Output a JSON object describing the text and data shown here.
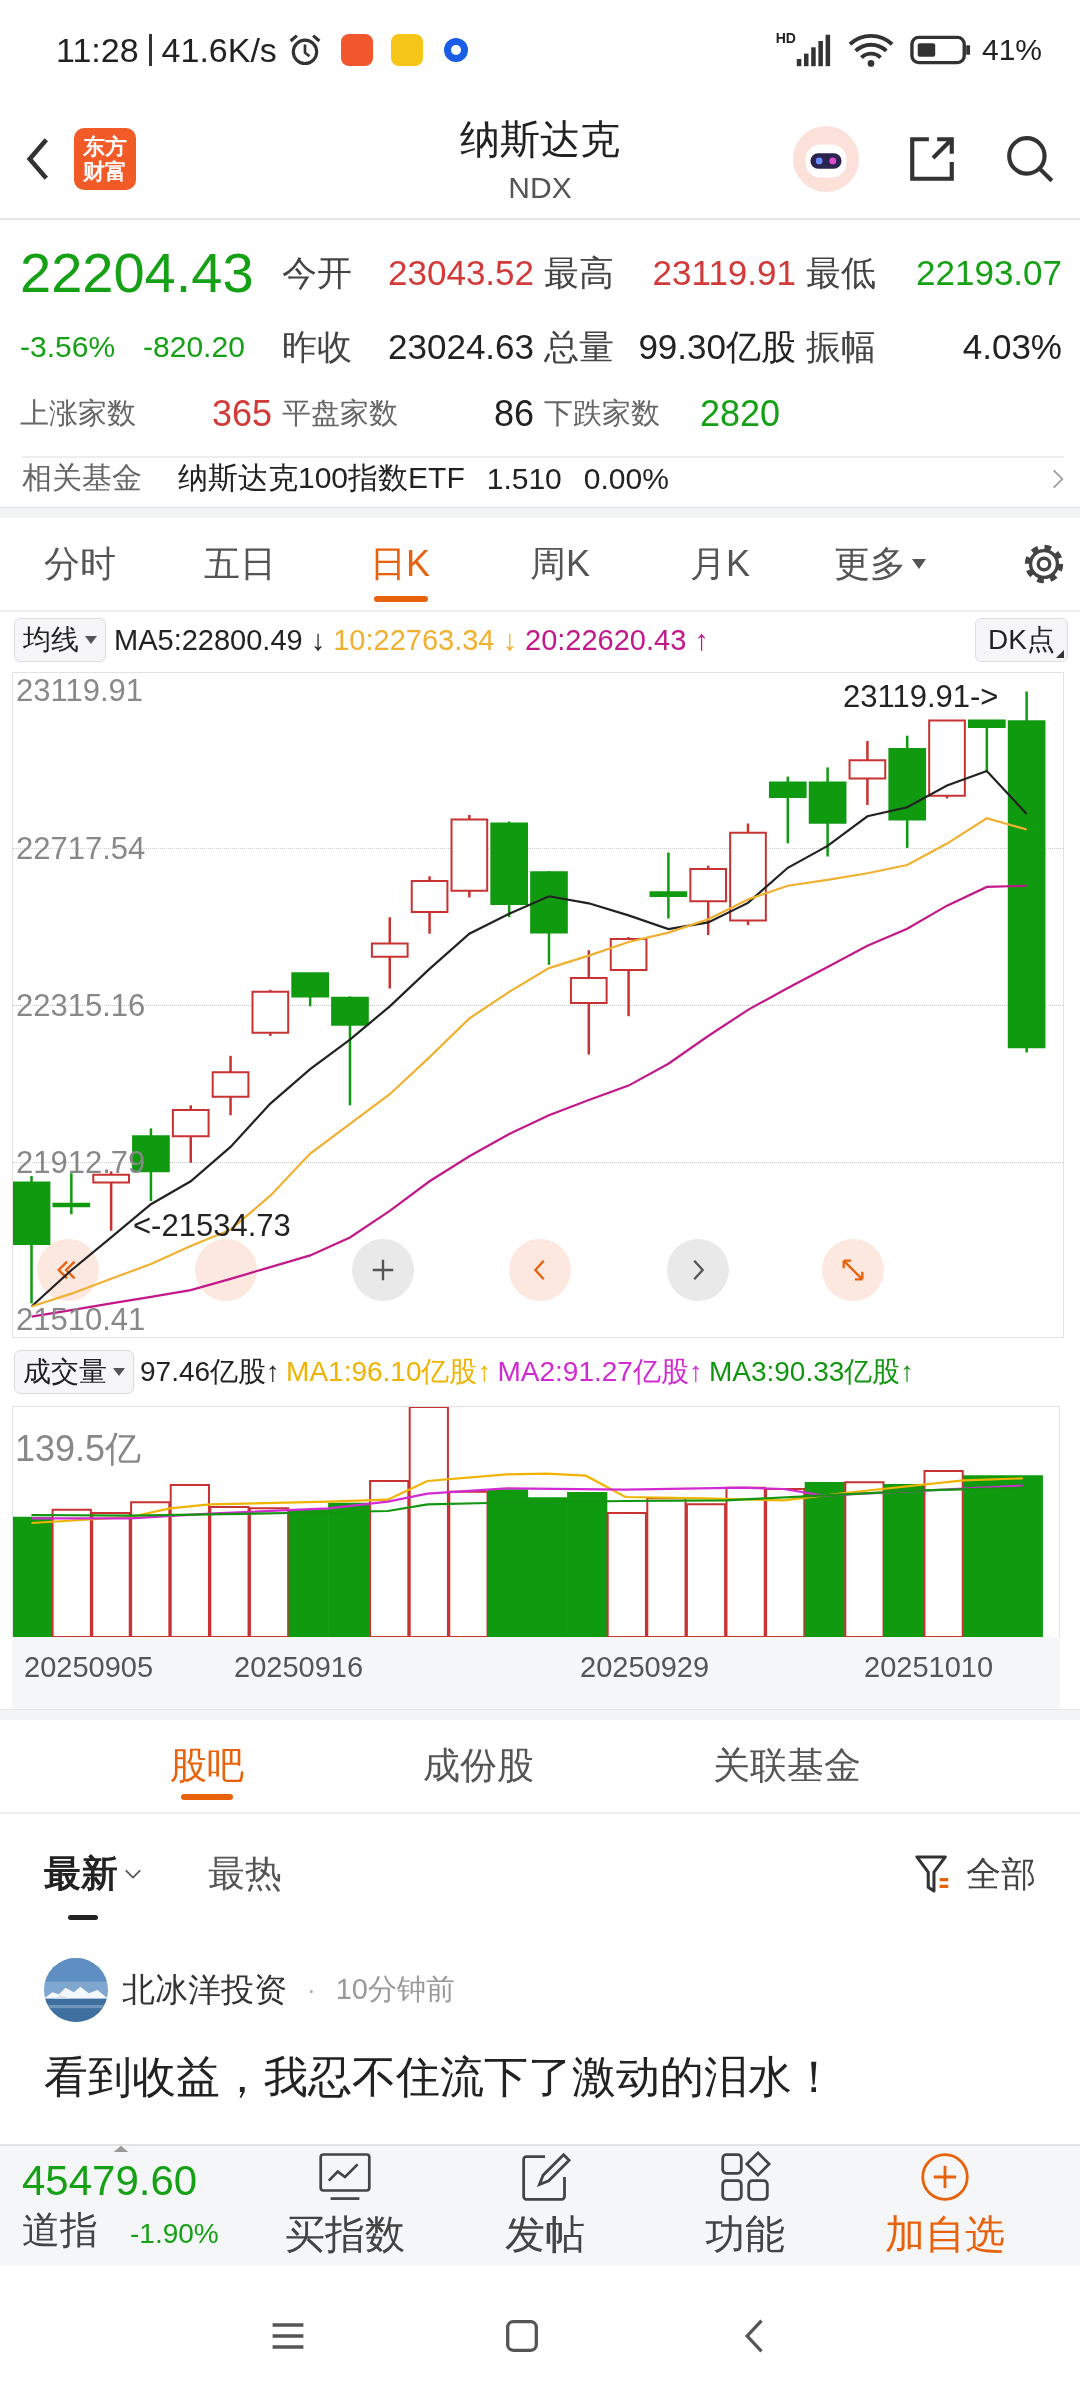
{
  "status_bar": {
    "time": "11:28",
    "speed": "41.6K/s",
    "network": "HD",
    "battery": "41%"
  },
  "header": {
    "logo_lines": [
      "东方",
      "财富"
    ],
    "title": "纳斯达克",
    "subtitle": "NDX"
  },
  "quote": {
    "price": "22204.43",
    "color": "#16a016",
    "change_pct": "-3.56%",
    "change": "-820.20",
    "stats": [
      {
        "label": "今开",
        "value": "23043.52",
        "color": "#d23a3a"
      },
      {
        "label": "最高",
        "value": "23119.91",
        "color": "#d23a3a"
      },
      {
        "label": "最低",
        "value": "22193.07",
        "color": "#16a016"
      },
      {
        "label": "昨收",
        "value": "23024.63",
        "color": "#222222"
      },
      {
        "label": "总量",
        "value": "99.30亿股",
        "color": "#222222"
      },
      {
        "label": "振幅",
        "value": "4.03%",
        "color": "#222222"
      }
    ],
    "breadth": [
      {
        "label": "上涨家数",
        "value": "365",
        "color": "#d23a3a"
      },
      {
        "label": "平盘家数",
        "value": "86",
        "color": "#222222"
      },
      {
        "label": "下跌家数",
        "value": "2820",
        "color": "#16a016"
      }
    ]
  },
  "fund": {
    "label": "相关基金",
    "name": "纳斯达克100指数ETF",
    "price": "1.510",
    "change": "0.00%"
  },
  "chart_tabs": [
    {
      "label": "分时",
      "selected": false,
      "kind": "tab"
    },
    {
      "label": "五日",
      "selected": false,
      "kind": "tab"
    },
    {
      "label": "日K",
      "selected": true,
      "kind": "tab"
    },
    {
      "label": "周K",
      "selected": false,
      "kind": "tab"
    },
    {
      "label": "月K",
      "selected": false,
      "kind": "tab"
    },
    {
      "label": "更多",
      "selected": false,
      "kind": "menu"
    }
  ],
  "ma_legend": {
    "selector": "均线",
    "dk": "DK点",
    "items": [
      {
        "text": "MA5:22800.49",
        "arrow": "↓",
        "color": "#222222"
      },
      {
        "text": "10:22763.34",
        "arrow": "↓",
        "color": "#f0b030"
      },
      {
        "text": "20:22620.43",
        "arrow": "↑",
        "color": "#c2188a"
      }
    ]
  },
  "kline": {
    "high_marker": "23119.91->",
    "low_marker": "<-21534.73",
    "chart_data": {
      "type": "line",
      "ylim": [
        21465,
        23166
      ],
      "grid": true,
      "yticks": [
        {
          "value": 23119.91,
          "label": "23119.91"
        },
        {
          "value": 22717.54,
          "label": "22717.54"
        },
        {
          "value": 22315.16,
          "label": "22315.16"
        },
        {
          "value": 21912.79,
          "label": "21912.79"
        },
        {
          "value": 21510.41,
          "label": "21510.41"
        }
      ],
      "series": [
        {
          "color": "#222222",
          "values": [
            21543,
            21636,
            21720,
            21805,
            21864,
            21952,
            22063,
            22151,
            22227,
            22312,
            22408,
            22498,
            22549,
            22594,
            22576,
            22545,
            22510,
            22527,
            22577,
            22667,
            22723,
            22799,
            22822,
            22878,
            22915,
            22805
          ]
        },
        {
          "color": "#f0b030",
          "values": [
            21543,
            21576,
            21614,
            21652,
            21698,
            21740,
            21827,
            21935,
            22011,
            22087,
            22182,
            22281,
            22349,
            22410,
            22442,
            22477,
            22501,
            22535,
            22586,
            22621,
            22636,
            22653,
            22674,
            22729,
            22794,
            22765
          ]
        },
        {
          "color": "#c2188a",
          "values": [
            21517,
            21534,
            21551,
            21568,
            21585,
            21614,
            21644,
            21674,
            21720,
            21788,
            21864,
            21928,
            21985,
            22033,
            22072,
            22109,
            22165,
            22236,
            22303,
            22359,
            22413,
            22467,
            22511,
            22570,
            22618,
            22621
          ]
        }
      ]
    },
    "controls": [
      {
        "kind": "rewind"
      },
      {
        "kind": "blank"
      },
      {
        "kind": "plus"
      },
      {
        "kind": "prev"
      },
      {
        "kind": "next"
      },
      {
        "kind": "expand"
      }
    ]
  },
  "volume_legend": {
    "selector": "成交量",
    "items": [
      {
        "text": "97.46亿股",
        "arrow": "↑",
        "color": "#222222"
      },
      {
        "text": "MA1:96.10亿股",
        "arrow": "↑",
        "color": "#f0b400"
      },
      {
        "text": "MA2:91.27亿股",
        "arrow": "↑",
        "color": "#d22ad2"
      },
      {
        "text": "MA3:90.33亿股",
        "arrow": "↑",
        "color": "#129612"
      }
    ]
  },
  "volume": {
    "max_label": "139.5亿",
    "dates": [
      "20250905",
      "20250916",
      "20250929",
      "20251010"
    ]
  },
  "section_tabs": [
    {
      "label": "股吧",
      "selected": true
    },
    {
      "label": "成份股",
      "selected": false
    },
    {
      "label": "关联基金",
      "selected": false
    }
  ],
  "sort_tabs": [
    {
      "label": "最新",
      "selected": true,
      "dropdown": true
    },
    {
      "label": "最热",
      "selected": false,
      "dropdown": false
    }
  ],
  "filter": "全部",
  "post": {
    "author": "北冰洋投资",
    "separator": "·",
    "time": "10分钟前",
    "lines": [
      "看到收益，我忍不住流下了激动的泪水！"
    ]
  },
  "bottom_bar": {
    "index_value": "45479.60",
    "index_name": "道指",
    "index_change": "-1.90%",
    "color": "#16a016",
    "actions": [
      {
        "label": "买指数",
        "kind": "chart",
        "highlight": false
      },
      {
        "label": "发帖",
        "kind": "edit",
        "highlight": false
      },
      {
        "label": "功能",
        "kind": "grid",
        "highlight": false
      },
      {
        "label": "加自选",
        "kind": "add",
        "highlight": true
      }
    ]
  }
}
